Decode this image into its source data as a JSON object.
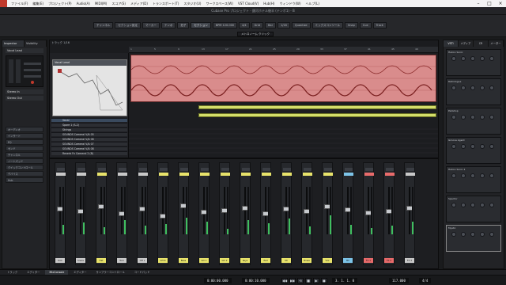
{
  "menu": {
    "items": [
      "ファイル(F)",
      "編集(E)",
      "プロジェクト(P)",
      "Audio(A)",
      "MIDI(M)",
      "スコア(S)",
      "メディア(D)",
      "トランスポート(T)",
      "スタジオ(U)",
      "ワークスペース(W)",
      "VST Cloud(V)",
      "Hub(H)",
      "ウィンドウ(W)",
      "ヘルプ(L)"
    ]
  },
  "titlebar": {
    "title": "Cubase Pro プロジェクト - 銀河ホテル後半 (テンポ1) - B"
  },
  "toolbar": {
    "buttons": [
      "チャンネル",
      "セクション設定",
      "マーカー",
      "テンポ",
      "拍子",
      "セクション",
      "BPM 120.000",
      "4/4",
      "Grid",
      "Bar",
      "1/16",
      "Quantize",
      "ミックスコンソール",
      "Snap",
      "Cue",
      "Track"
    ],
    "counter": "メトロノーム クリック"
  },
  "inspector": {
    "tabs": [
      "Inspector",
      "Visibility"
    ],
    "track_name": "Vocal Lead",
    "sections": [
      "オーディオ",
      "インサート",
      "EQ",
      "センド",
      "チャンネル",
      "ノートパッド",
      "クイックコントロール",
      "デバイス",
      "Hub"
    ],
    "routing": [
      "Stereo In",
      "Stereo Out"
    ]
  },
  "project": {
    "toolbar_label": "トラック 1/16",
    "preview_title": "Vocal Lead",
    "ruler": [
      "1",
      "5",
      "9",
      "13",
      "17",
      "21",
      "25",
      "29",
      "33",
      "37",
      "41",
      "45",
      "49"
    ],
    "tracks": [
      "Vocal",
      "Spare 1 (S-2)",
      "Strings",
      "SOUNDS Cameral V/A 05",
      "SOUNDS Cameral V/A 06",
      "SOUNDS Cameral V/A 07",
      "SOUNDS Cameral V/A 08",
      "Reverb Fx Cameral 2 (B)"
    ]
  },
  "mixer": {
    "channels": [
      {
        "name": "Kick",
        "level": 0.55,
        "meter": 0.2,
        "color": "#c8c8c8"
      },
      {
        "name": "Snare",
        "level": 0.5,
        "meter": 0.25,
        "color": "#c8c8c8"
      },
      {
        "name": "Hat",
        "level": 0.6,
        "meter": 0.15,
        "color": "#e8e36b"
      },
      {
        "name": "Tom",
        "level": 0.45,
        "meter": 0.3,
        "color": "#c8c8c8"
      },
      {
        "name": "OH L",
        "level": 0.55,
        "meter": 0.18,
        "color": "#c8c8c8"
      },
      {
        "name": "OH R",
        "level": 0.4,
        "meter": 0.22,
        "color": "#e8e36b"
      },
      {
        "name": "Bass",
        "level": 0.62,
        "meter": 0.35,
        "color": "#e8e36b"
      },
      {
        "name": "Gtr 1",
        "level": 0.48,
        "meter": 0.27,
        "color": "#e8e36b"
      },
      {
        "name": "Gtr 2",
        "level": 0.52,
        "meter": 0.12,
        "color": "#e8e36b"
      },
      {
        "name": "Keys",
        "level": 0.58,
        "meter": 0.3,
        "color": "#e8e36b"
      },
      {
        "name": "Pad",
        "level": 0.45,
        "meter": 0.24,
        "color": "#e8e36b"
      },
      {
        "name": "Str",
        "level": 0.55,
        "meter": 0.33,
        "color": "#e8e36b"
      },
      {
        "name": "Brass",
        "level": 0.5,
        "meter": 0.16,
        "color": "#e8e36b"
      },
      {
        "name": "Vox",
        "level": 0.6,
        "meter": 0.4,
        "color": "#e8e36b"
      },
      {
        "name": "BV",
        "level": 0.53,
        "meter": 0.2,
        "color": "#7dc4e8"
      },
      {
        "name": "FX 1",
        "level": 0.47,
        "meter": 0.14,
        "color": "#e86b6b"
      },
      {
        "name": "FX 2",
        "level": 0.5,
        "meter": 0.19,
        "color": "#e86b6b"
      },
      {
        "name": "FX 3",
        "level": 0.58,
        "meter": 0.26,
        "color": "#c8c8c8"
      }
    ]
  },
  "rightzone": {
    "tabs": [
      "VSTi",
      "メディア",
      "CR",
      "メーター"
    ],
    "rack_slots": [
      "Halion Sonic",
      "Retrologue",
      "Padshop",
      "Groove Agent",
      "Halion Sonic 2",
      "Spector",
      "Mystic"
    ]
  },
  "lowerzone": {
    "tabs": [
      "トラック",
      "エディター",
      "MixConsole",
      "エディター",
      "サンプラーコントロール",
      "コードパッド"
    ]
  },
  "transport": {
    "left_time": "0:00:00.000",
    "right_time": "0:00:10.000",
    "position": "3. 1. 1.  0",
    "tempo": "117.000",
    "signature": "4/4"
  }
}
